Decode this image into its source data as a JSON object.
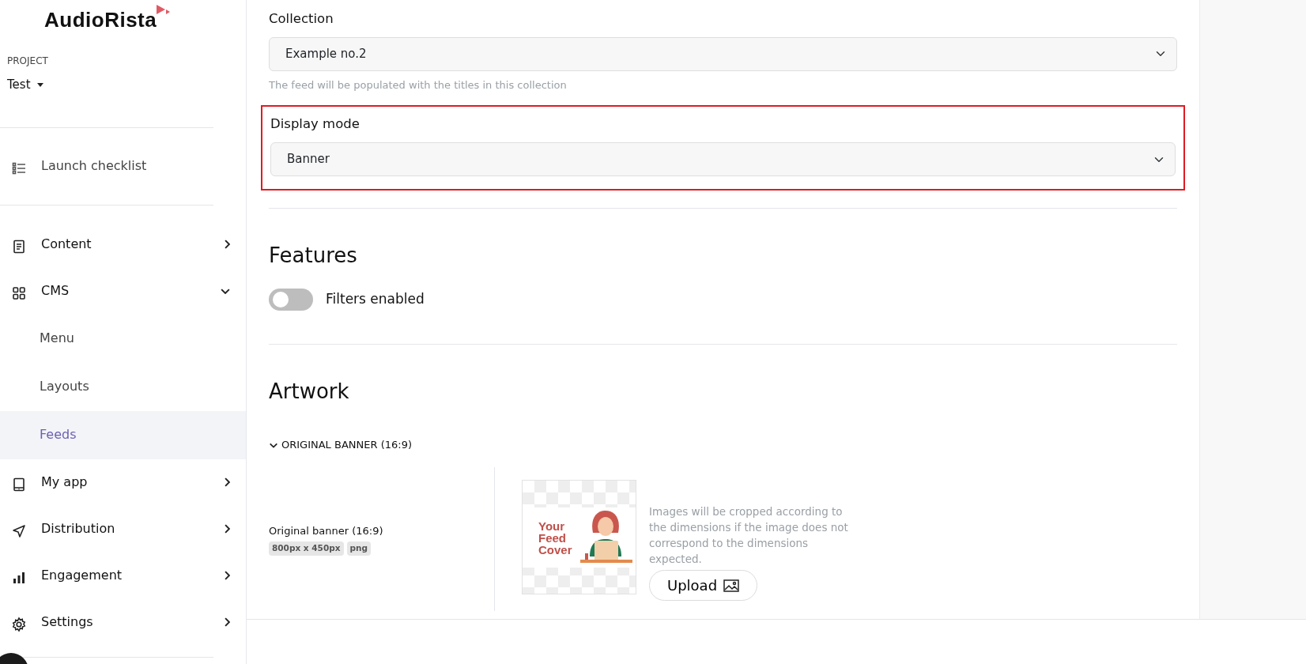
{
  "brand": {
    "name": "AudioRista"
  },
  "project": {
    "label": "PROJECT",
    "name": "Test"
  },
  "checklist": {
    "label": "Launch checklist"
  },
  "sidebar": {
    "items": [
      {
        "label": "Content",
        "expanded": false
      },
      {
        "label": "CMS",
        "expanded": true,
        "children": [
          {
            "label": "Menu",
            "selected": false
          },
          {
            "label": "Layouts",
            "selected": false
          },
          {
            "label": "Feeds",
            "selected": true
          }
        ]
      },
      {
        "label": "My app",
        "expanded": false
      },
      {
        "label": "Distribution",
        "expanded": false
      },
      {
        "label": "Engagement",
        "expanded": false
      },
      {
        "label": "Settings",
        "expanded": false
      }
    ]
  },
  "collection": {
    "label": "Collection",
    "value": "Example no.2",
    "help": "The feed will be populated with the titles in this collection"
  },
  "display_mode": {
    "label": "Display mode",
    "value": "Banner",
    "highlighted": true
  },
  "features": {
    "title": "Features",
    "toggles": [
      {
        "label": "Filters enabled",
        "on": false
      }
    ]
  },
  "artwork": {
    "title": "Artwork",
    "sections": [
      {
        "title": "ORIGINAL BANNER (16:9)",
        "expanded": true,
        "name": "Original banner (16:9)",
        "tags": [
          "800px x 450px",
          "png"
        ],
        "preview_text": [
          "Your",
          "Feed",
          "Cover"
        ],
        "note": "Images will be cropped according to the dimensions if the image does not correspond to the dimensions expected.",
        "upload": "Upload"
      }
    ]
  }
}
